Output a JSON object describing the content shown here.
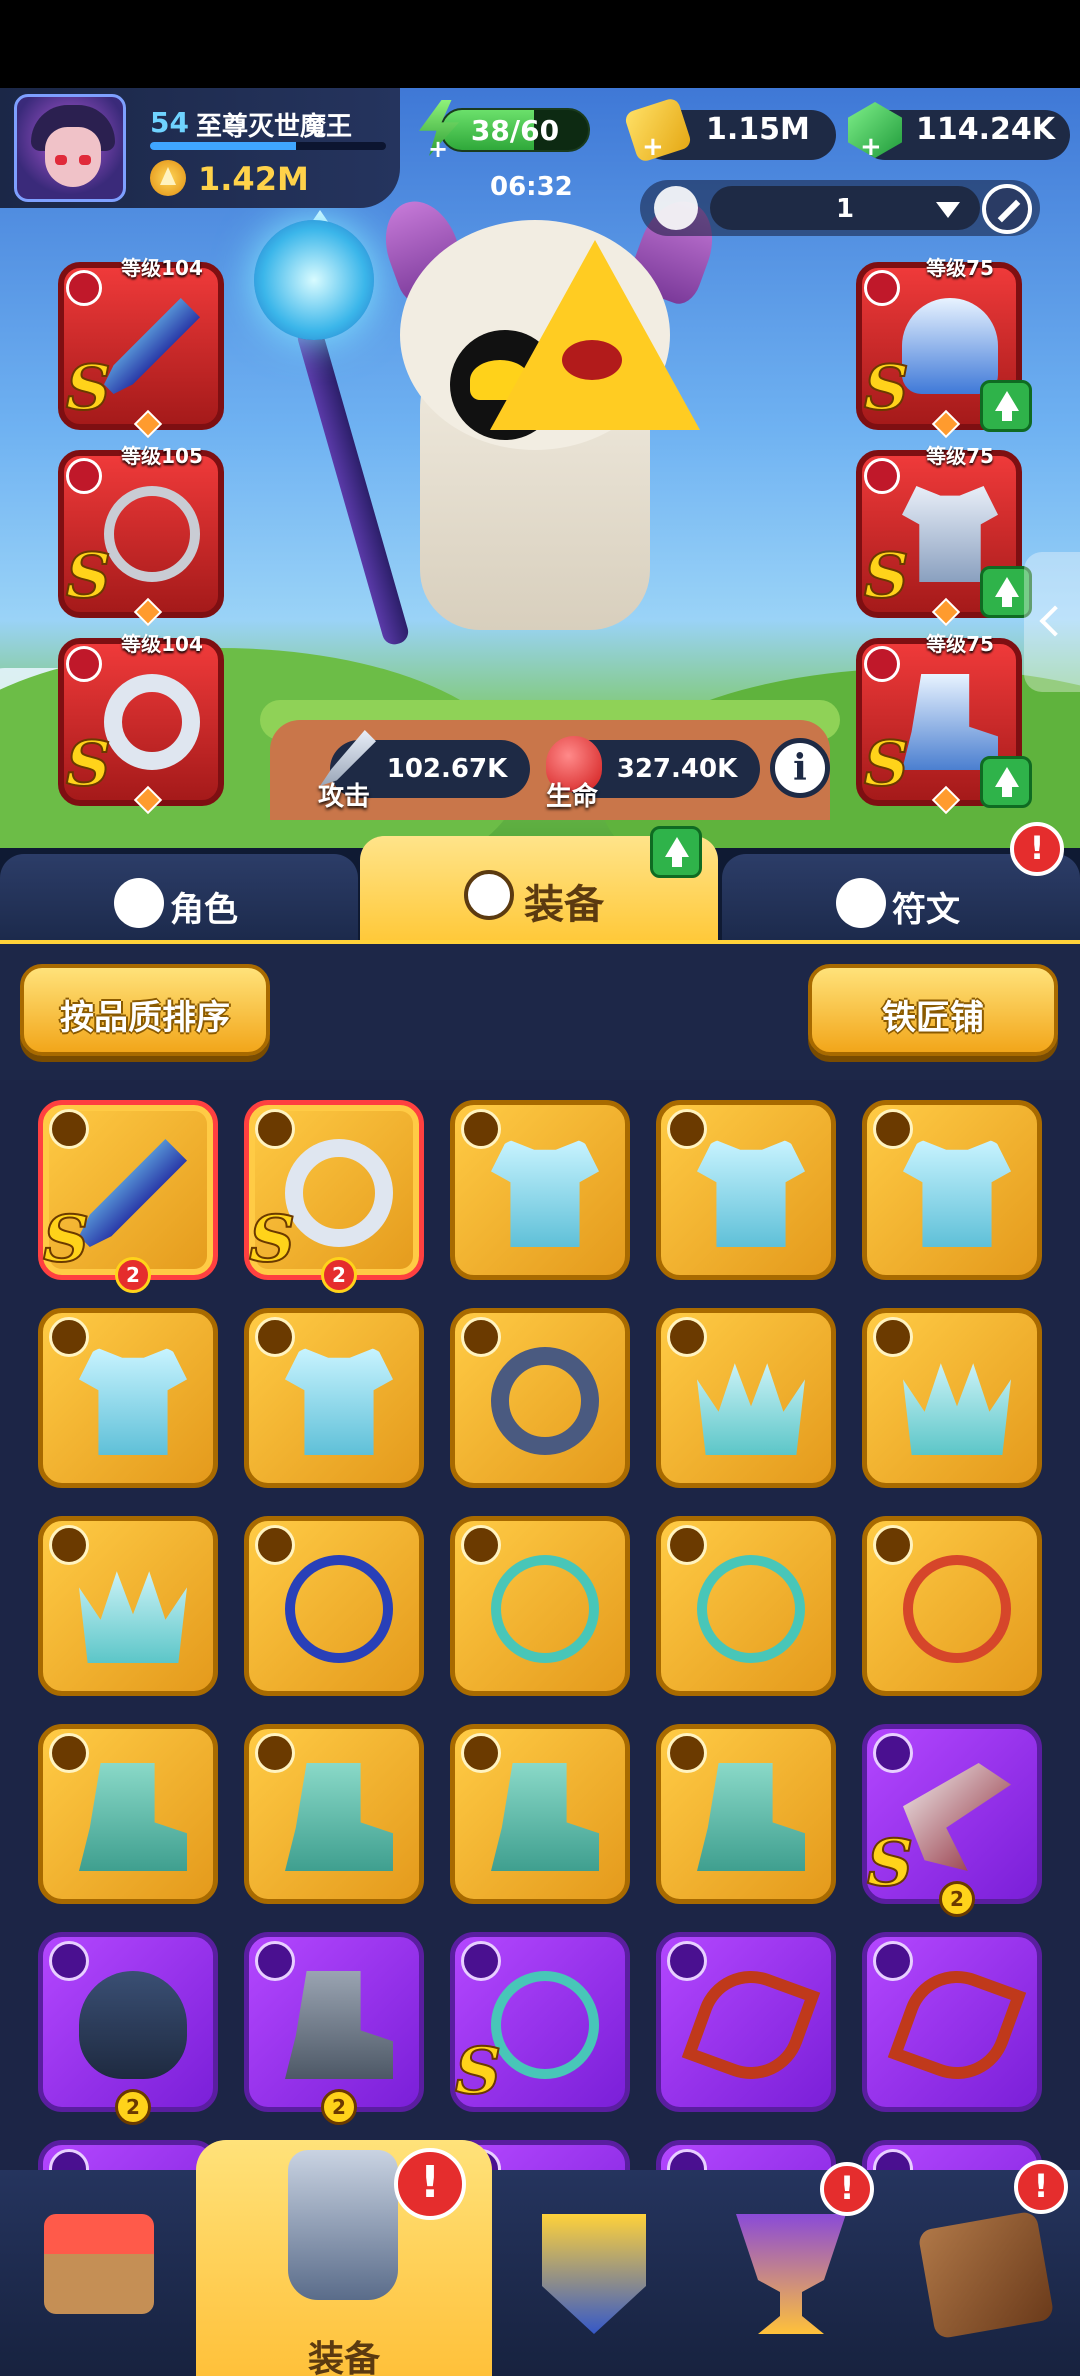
{
  "player": {
    "level": "54",
    "name": "至尊灭世魔王",
    "power": "1.42M",
    "xp_fraction": 0.62
  },
  "resources": {
    "energy_text": "38/60",
    "energy_fraction": 0.633,
    "timer": "06:32",
    "gold": "1.15M",
    "gems": "114.24K"
  },
  "loadout": {
    "selected": "1"
  },
  "equipped": {
    "left": [
      {
        "level": "等级104",
        "rank": "S",
        "icon": "staff-icon"
      },
      {
        "level": "等级105",
        "rank": "S",
        "icon": "necklace-icon"
      },
      {
        "level": "等级104",
        "rank": "S",
        "icon": "ring-icon"
      }
    ],
    "right": [
      {
        "level": "等级75",
        "rank": "S",
        "icon": "helmet-icon"
      },
      {
        "level": "等级75",
        "rank": "S",
        "icon": "chest-armor-icon"
      },
      {
        "level": "等级75",
        "rank": "S",
        "icon": "boots-icon"
      }
    ]
  },
  "stats": {
    "attack_label": "攻击",
    "attack": "102.67K",
    "hp_label": "生命",
    "hp": "327.40K",
    "info": "i"
  },
  "tabs": [
    {
      "label": "角色"
    },
    {
      "label": "装备"
    },
    {
      "label": "符文"
    }
  ],
  "alerts": {
    "mark": "!"
  },
  "buttons": {
    "sort": "按品质排序",
    "blacksmith": "铁匠铺"
  },
  "inventory": [
    {
      "rank": "S",
      "stack": "2",
      "icon": "staff-icon"
    },
    {
      "rank": "S",
      "stack": "2",
      "icon": "ring-icon"
    },
    {
      "icon": "armor-icon"
    },
    {
      "icon": "armor-icon"
    },
    {
      "icon": "armor-icon"
    },
    {
      "icon": "armor-icon"
    },
    {
      "icon": "armor-icon"
    },
    {
      "icon": "ring-icon"
    },
    {
      "icon": "crown-icon"
    },
    {
      "icon": "crown-icon"
    },
    {
      "icon": "crown-icon"
    },
    {
      "icon": "necklace-icon"
    },
    {
      "icon": "necklace-icon"
    },
    {
      "icon": "necklace-icon"
    },
    {
      "icon": "necklace-icon"
    },
    {
      "icon": "boots-icon"
    },
    {
      "icon": "boots-icon"
    },
    {
      "icon": "boots-icon"
    },
    {
      "icon": "boots-icon"
    },
    {
      "rank": "S",
      "stack": "2",
      "icon": "crossbow-icon"
    },
    {
      "stack": "2",
      "icon": "mask-icon"
    },
    {
      "stack": "2",
      "icon": "boots-icon"
    },
    {
      "rank": "S",
      "icon": "necklace-icon"
    },
    {
      "icon": "bow-icon"
    },
    {
      "icon": "bow-icon"
    }
  ],
  "bottom_nav": {
    "equipment_label": "装备"
  },
  "colors": {
    "gold_card": "#ffcb45",
    "purple_card": "#b447ff",
    "red_card": "#ef3a3a",
    "accent": "#ffc93a"
  }
}
